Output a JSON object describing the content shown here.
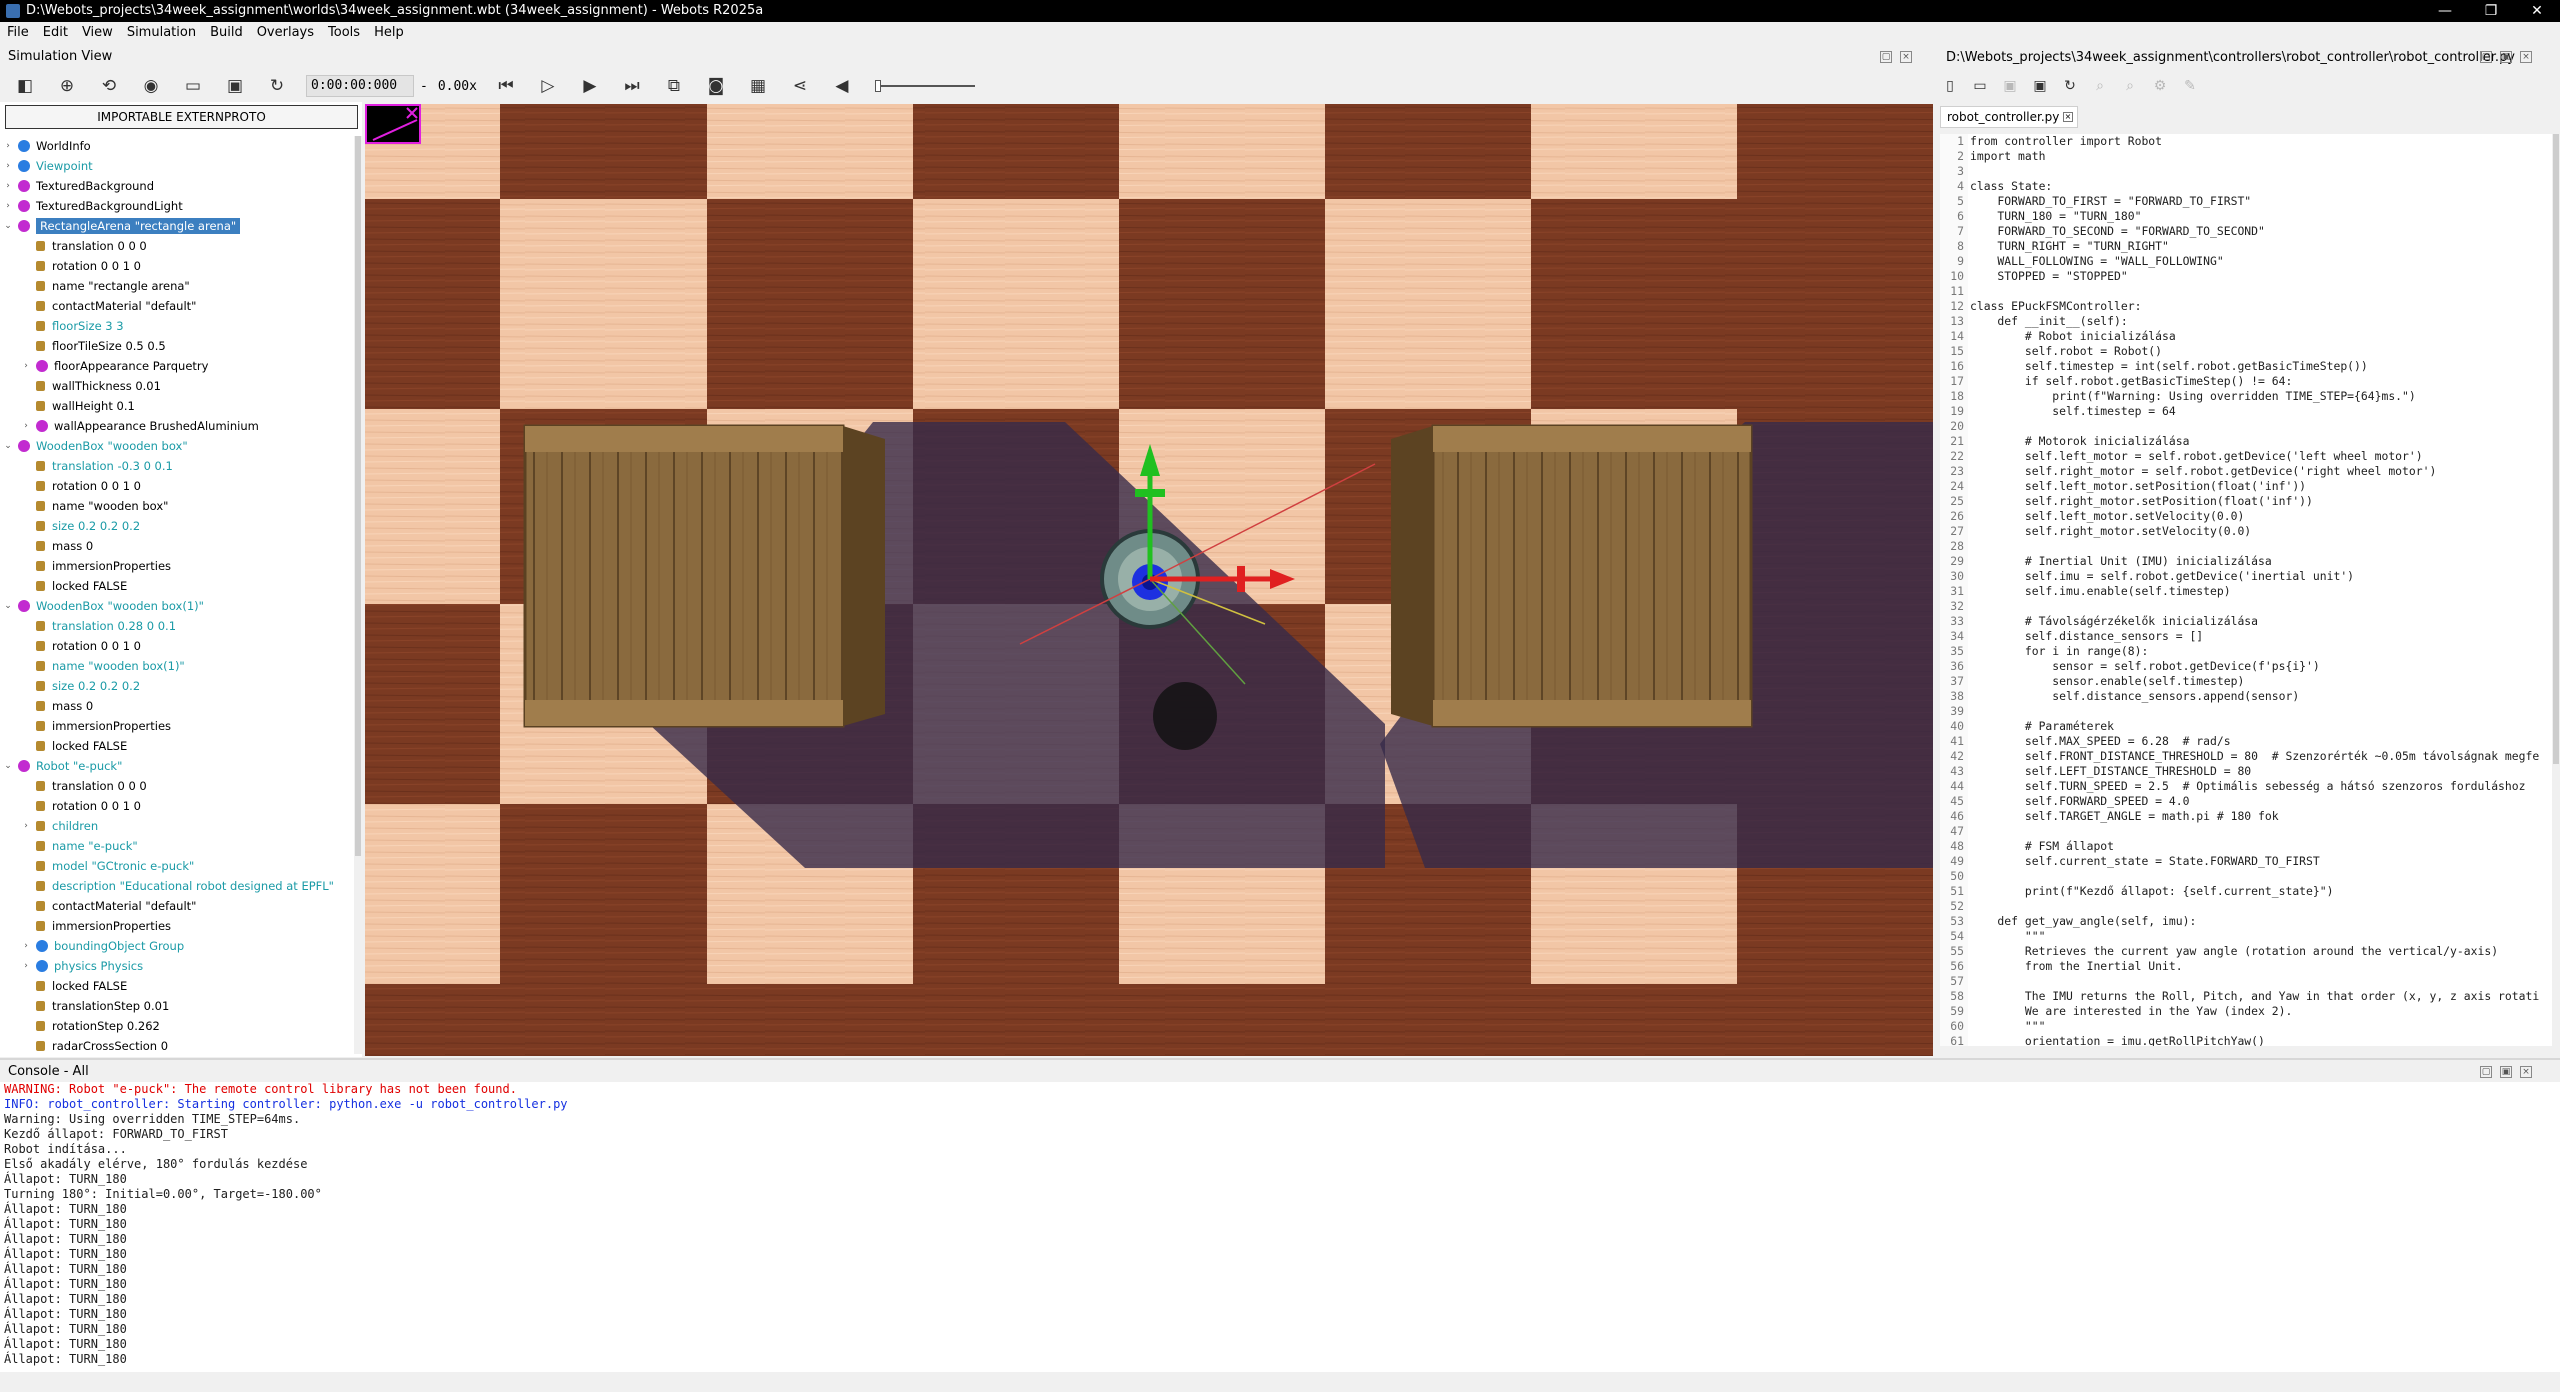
{
  "window": {
    "title": "D:\\Webots_projects\\34week_assignment\\worlds\\34week_assignment.wbt (34week_assignment) - Webots R2025a",
    "minimize": "—",
    "maximize": "❐",
    "close": "✕"
  },
  "menu": [
    "File",
    "Edit",
    "View",
    "Simulation",
    "Build",
    "Overlays",
    "Tools",
    "Help"
  ],
  "simulation_view": {
    "header": "Simulation View",
    "time": "0:00:00:000",
    "speed_separator": "-",
    "speed": "0.00x",
    "volume_level": 0
  },
  "scene_tree": {
    "import_button": "IMPORTABLE EXTERNPROTO",
    "rows": [
      {
        "arrow": "›",
        "type": "node",
        "color": "#2a7de1",
        "label": "WorldInfo",
        "mod": false
      },
      {
        "arrow": "›",
        "type": "node",
        "color": "#2a7de1",
        "label": "Viewpoint",
        "mod": true
      },
      {
        "arrow": "›",
        "type": "node",
        "color": "#c22bd0",
        "label": "TexturedBackground",
        "mod": false
      },
      {
        "arrow": "›",
        "type": "node",
        "color": "#c22bd0",
        "label": "TexturedBackgroundLight",
        "mod": false
      },
      {
        "arrow": "⌄",
        "type": "node",
        "color": "#c22bd0",
        "label": "RectangleArena \"rectangle arena\"",
        "mod": false,
        "selected": true
      },
      {
        "indent": 1,
        "type": "field",
        "label": "translation 0 0 0",
        "mod": false
      },
      {
        "indent": 1,
        "type": "field",
        "label": "rotation 0 0 1 0",
        "mod": false
      },
      {
        "indent": 1,
        "type": "field",
        "label": "name \"rectangle arena\"",
        "mod": false
      },
      {
        "indent": 1,
        "type": "field",
        "label": "contactMaterial \"default\"",
        "mod": false
      },
      {
        "indent": 1,
        "type": "field",
        "label": "floorSize 3 3",
        "mod": true
      },
      {
        "indent": 1,
        "type": "field",
        "label": "floorTileSize 0.5 0.5",
        "mod": false
      },
      {
        "indent": 1,
        "arrow": "›",
        "type": "node",
        "color": "#c22bd0",
        "label": "floorAppearance Parquetry",
        "mod": false
      },
      {
        "indent": 1,
        "type": "field",
        "label": "wallThickness 0.01",
        "mod": false
      },
      {
        "indent": 1,
        "type": "field",
        "label": "wallHeight 0.1",
        "mod": false
      },
      {
        "indent": 1,
        "arrow": "›",
        "type": "node",
        "color": "#c22bd0",
        "label": "wallAppearance BrushedAluminium",
        "mod": false
      },
      {
        "arrow": "⌄",
        "type": "node",
        "color": "#c22bd0",
        "label": "WoodenBox \"wooden box\"",
        "mod": true
      },
      {
        "indent": 1,
        "type": "field",
        "label": "translation -0.3 0 0.1",
        "mod": true
      },
      {
        "indent": 1,
        "type": "field",
        "label": "rotation 0 0 1 0",
        "mod": false
      },
      {
        "indent": 1,
        "type": "field",
        "label": "name \"wooden box\"",
        "mod": false
      },
      {
        "indent": 1,
        "type": "field",
        "label": "size 0.2 0.2 0.2",
        "mod": true
      },
      {
        "indent": 1,
        "type": "field",
        "label": "mass 0",
        "mod": false
      },
      {
        "indent": 1,
        "type": "field",
        "label": "immersionProperties",
        "mod": false
      },
      {
        "indent": 1,
        "type": "field",
        "label": "locked FALSE",
        "mod": false
      },
      {
        "arrow": "⌄",
        "type": "node",
        "color": "#c22bd0",
        "label": "WoodenBox \"wooden box(1)\"",
        "mod": true
      },
      {
        "indent": 1,
        "type": "field",
        "label": "translation 0.28 0 0.1",
        "mod": true
      },
      {
        "indent": 1,
        "type": "field",
        "label": "rotation 0 0 1 0",
        "mod": false
      },
      {
        "indent": 1,
        "type": "field",
        "label": "name \"wooden box(1)\"",
        "mod": true
      },
      {
        "indent": 1,
        "type": "field",
        "label": "size 0.2 0.2 0.2",
        "mod": true
      },
      {
        "indent": 1,
        "type": "field",
        "label": "mass 0",
        "mod": false
      },
      {
        "indent": 1,
        "type": "field",
        "label": "immersionProperties",
        "mod": false
      },
      {
        "indent": 1,
        "type": "field",
        "label": "locked FALSE",
        "mod": false
      },
      {
        "arrow": "⌄",
        "type": "node",
        "color": "#c22bd0",
        "label": "Robot \"e-puck\"",
        "mod": true
      },
      {
        "indent": 1,
        "type": "field",
        "label": "translation 0 0 0",
        "mod": false
      },
      {
        "indent": 1,
        "type": "field",
        "label": "rotation 0 0 1 0",
        "mod": false
      },
      {
        "indent": 1,
        "arrow": "›",
        "type": "field",
        "label": "children",
        "mod": true
      },
      {
        "indent": 1,
        "type": "field",
        "label": "name \"e-puck\"",
        "mod": true
      },
      {
        "indent": 1,
        "type": "field",
        "label": "model \"GCtronic e-puck\"",
        "mod": true
      },
      {
        "indent": 1,
        "type": "field",
        "label": "description \"Educational robot designed at EPFL\"",
        "mod": true
      },
      {
        "indent": 1,
        "type": "field",
        "label": "contactMaterial \"default\"",
        "mod": false
      },
      {
        "indent": 1,
        "type": "field",
        "label": "immersionProperties",
        "mod": false
      },
      {
        "indent": 1,
        "arrow": "›",
        "type": "node",
        "color": "#2a7de1",
        "label": "boundingObject Group",
        "mod": true
      },
      {
        "indent": 1,
        "arrow": "›",
        "type": "node",
        "color": "#2a7de1",
        "label": "physics Physics",
        "mod": true
      },
      {
        "indent": 1,
        "type": "field",
        "label": "locked FALSE",
        "mod": false
      },
      {
        "indent": 1,
        "type": "field",
        "label": "translationStep 0.01",
        "mod": false
      },
      {
        "indent": 1,
        "type": "field",
        "label": "rotationStep 0.262",
        "mod": false
      },
      {
        "indent": 1,
        "type": "field",
        "label": "radarCrossSection 0",
        "mod": false
      }
    ]
  },
  "editor": {
    "path": "D:\\Webots_projects\\34week_assignment\\controllers\\robot_controller\\robot_controller.py",
    "tab": "robot_controller.py",
    "tab_close": "×",
    "lines": [
      "from controller import Robot",
      "import math",
      "",
      "class State:",
      "    FORWARD_TO_FIRST = \"FORWARD_TO_FIRST\"",
      "    TURN_180 = \"TURN_180\"",
      "    FORWARD_TO_SECOND = \"FORWARD_TO_SECOND\"",
      "    TURN_RIGHT = \"TURN_RIGHT\"",
      "    WALL_FOLLOWING = \"WALL_FOLLOWING\"",
      "    STOPPED = \"STOPPED\"",
      "",
      "class EPuckFSMController:",
      "    def __init__(self):",
      "        # Robot inicializálása",
      "        self.robot = Robot()",
      "        self.timestep = int(self.robot.getBasicTimeStep())",
      "        if self.robot.getBasicTimeStep() != 64:",
      "            print(f\"Warning: Using overridden TIME_STEP={64}ms.\")",
      "            self.timestep = 64",
      "",
      "        # Motorok inicializálása",
      "        self.left_motor = self.robot.getDevice('left wheel motor')",
      "        self.right_motor = self.robot.getDevice('right wheel motor')",
      "        self.left_motor.setPosition(float('inf'))",
      "        self.right_motor.setPosition(float('inf'))",
      "        self.left_motor.setVelocity(0.0)",
      "        self.right_motor.setVelocity(0.0)",
      "",
      "        # Inertial Unit (IMU) inicializálása",
      "        self.imu = self.robot.getDevice('inertial unit')",
      "        self.imu.enable(self.timestep)",
      "",
      "        # Távolságérzékelők inicializálása",
      "        self.distance_sensors = []",
      "        for i in range(8):",
      "            sensor = self.robot.getDevice(f'ps{i}')",
      "            sensor.enable(self.timestep)",
      "            self.distance_sensors.append(sensor)",
      "",
      "        # Paraméterek",
      "        self.MAX_SPEED = 6.28  # rad/s",
      "        self.FRONT_DISTANCE_THRESHOLD = 80  # Szenzorérték ~0.05m távolságnak megfe",
      "        self.LEFT_DISTANCE_THRESHOLD = 80",
      "        self.TURN_SPEED = 2.5  # Optimális sebesség a hátsó szenzoros forduláshoz",
      "        self.FORWARD_SPEED = 4.0",
      "        self.TARGET_ANGLE = math.pi # 180 fok",
      "",
      "        # FSM állapot",
      "        self.current_state = State.FORWARD_TO_FIRST",
      "",
      "        print(f\"Kezdő állapot: {self.current_state}\")",
      "",
      "    def get_yaw_angle(self, imu):",
      "        \"\"\"",
      "        Retrieves the current yaw angle (rotation around the vertical/y-axis)",
      "        from the Inertial Unit.",
      "",
      "        The IMU returns the Roll, Pitch, and Yaw in that order (x, y, z axis rotati",
      "        We are interested in the Yaw (index 2).",
      "        \"\"\"",
      "        orientation = imu.getRollPitchYaw()"
    ]
  },
  "console": {
    "header": "Console - All",
    "lines": [
      {
        "kind": "warn",
        "text": "WARNING: Robot \"e-puck\": The remote control library has not been found."
      },
      {
        "kind": "info",
        "text": "INFO: robot_controller: Starting controller: python.exe -u robot_controller.py"
      },
      {
        "kind": "normal",
        "text": "Warning: Using overridden TIME_STEP=64ms."
      },
      {
        "kind": "normal",
        "text": "Kezdő állapot: FORWARD_TO_FIRST"
      },
      {
        "kind": "normal",
        "text": "Robot indítása..."
      },
      {
        "kind": "normal",
        "text": "Első akadály elérve, 180° fordulás kezdése"
      },
      {
        "kind": "normal",
        "text": "Állapot: TURN_180"
      },
      {
        "kind": "normal",
        "text": "Turning 180°: Initial=0.00°, Target=-180.00°"
      },
      {
        "kind": "normal",
        "text": "Állapot: TURN_180"
      },
      {
        "kind": "normal",
        "text": "Állapot: TURN_180"
      },
      {
        "kind": "normal",
        "text": "Állapot: TURN_180"
      },
      {
        "kind": "normal",
        "text": "Állapot: TURN_180"
      },
      {
        "kind": "normal",
        "text": "Állapot: TURN_180"
      },
      {
        "kind": "normal",
        "text": "Állapot: TURN_180"
      },
      {
        "kind": "normal",
        "text": "Állapot: TURN_180"
      },
      {
        "kind": "normal",
        "text": "Állapot: TURN_180"
      },
      {
        "kind": "normal",
        "text": "Állapot: TURN_180"
      },
      {
        "kind": "normal",
        "text": "Állapot: TURN_180"
      },
      {
        "kind": "normal",
        "text": "Állapot: TURN_180"
      }
    ]
  },
  "colors": {
    "tile_dark": "#7a3a22",
    "tile_light": "#f2c8a8",
    "selection": "#3c7fc0",
    "modified_field": "#1a9aa6",
    "warning": "#e00000",
    "info": "#1530e0"
  }
}
